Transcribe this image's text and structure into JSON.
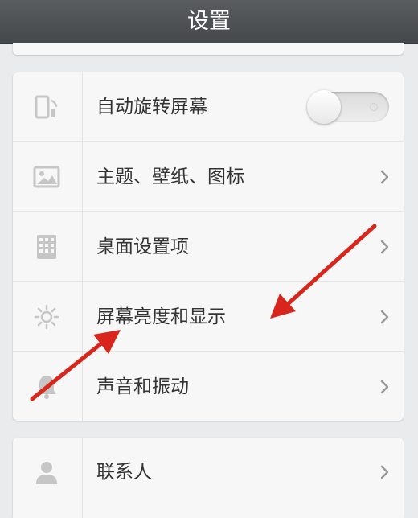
{
  "header": {
    "title": "设置"
  },
  "settings_group_1": [
    {
      "icon": "screen-rotate-icon",
      "label": "自动旋转屏幕",
      "control": "toggle",
      "toggle_on": false
    },
    {
      "icon": "picture-icon",
      "label": "主题、壁纸、图标",
      "control": "chevron"
    },
    {
      "icon": "grid-icon",
      "label": "桌面设置项",
      "control": "chevron"
    },
    {
      "icon": "brightness-icon",
      "label": "屏幕亮度和显示",
      "control": "chevron"
    },
    {
      "icon": "bell-icon",
      "label": "声音和振动",
      "control": "chevron"
    }
  ],
  "settings_group_2": [
    {
      "icon": "contact-icon",
      "label": "联系人",
      "control": "chevron"
    }
  ],
  "colors": {
    "header_bg": "#4f5255",
    "background": "#e9ebed",
    "card_bg": "#f7f7f7",
    "text": "#333333",
    "icon": "#c6c6c6",
    "annotation_arrow": "#d9261c"
  }
}
